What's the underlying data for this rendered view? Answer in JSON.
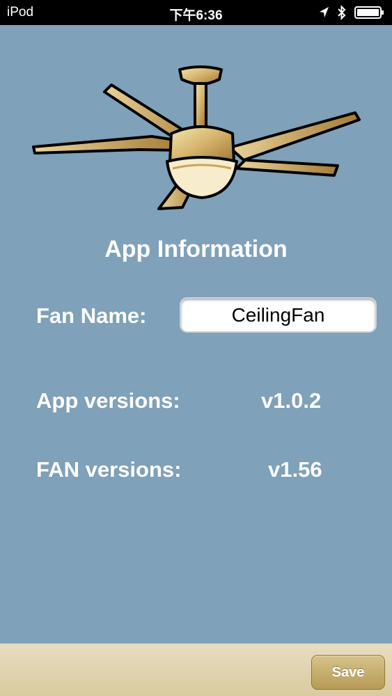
{
  "status_bar": {
    "carrier": "iPod",
    "time": "下午6:36",
    "icons": [
      "location-arrow-icon",
      "bluetooth-icon",
      "battery-icon"
    ]
  },
  "illustration": {
    "icon": "ceiling-fan-icon"
  },
  "main": {
    "title": "App Information",
    "fan_name_label": "Fan Name:",
    "fan_name_value": "CeilingFan",
    "app_versions_label": "App versions:",
    "app_versions_value": "v1.0.2",
    "fan_versions_label": "FAN versions:",
    "fan_versions_value": "v1.56"
  },
  "toolbar": {
    "save_label": "Save"
  },
  "colors": {
    "background": "#7fa1b9",
    "status_bar": "#000000",
    "toolbar": "#e0d4b0",
    "button_gold": "#c6ad6f",
    "fan_gold": "#c9a45c"
  }
}
